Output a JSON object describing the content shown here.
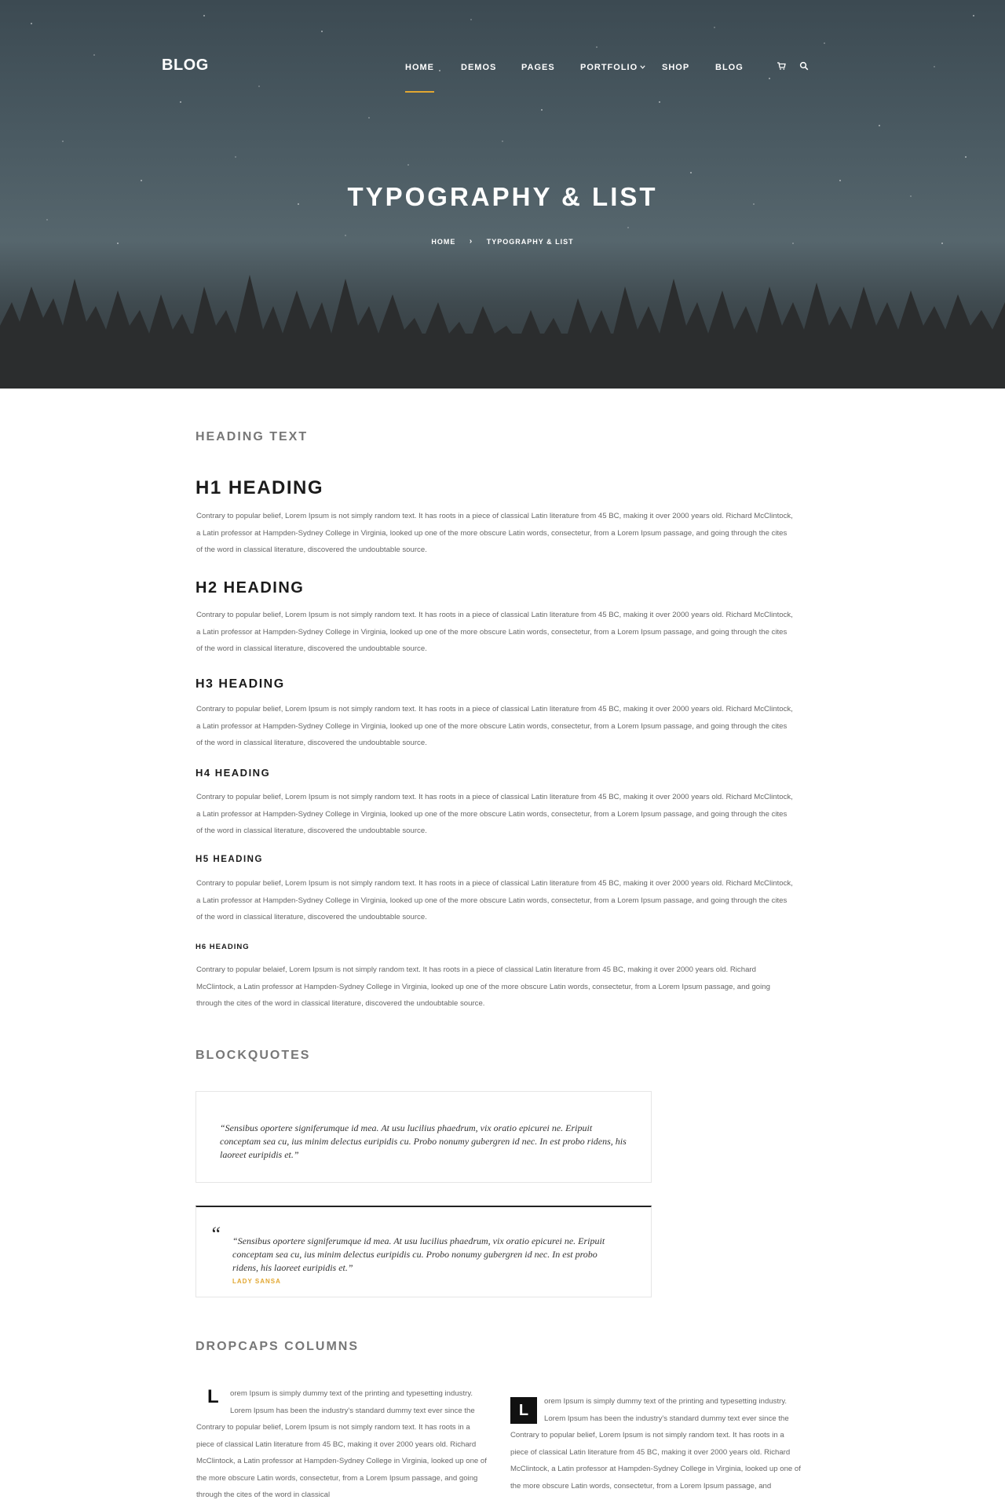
{
  "nav": {
    "logo": "BLOG",
    "items": [
      "HOME",
      "DEMOS",
      "PAGES",
      "PORTFOLIO",
      "SHOP",
      "BLOG"
    ],
    "active_index": 0
  },
  "hero": {
    "title": "TYPOGRAPHY & LIST",
    "breadcrumb": {
      "home": "HOME",
      "separator": "›",
      "current": "TYPOGRAPHY & LIST"
    }
  },
  "colors": {
    "accent": "#e2a731",
    "heading": "#1b1b1b",
    "body_text": "#666666",
    "section_title": "#777777"
  },
  "icons": {
    "cart": "cart-icon",
    "search": "search-icon",
    "chevron": "chevron-down-icon"
  },
  "heading_section": {
    "title": "HEADING TEXT",
    "headings": [
      {
        "label": "H1 HEADING",
        "paragraph": "Contrary to popular belief, Lorem Ipsum is not simply random text. It has roots in a piece of classical Latin literature from 45 BC, making it over 2000 years old. Richard McClintock, a Latin professor at Hampden-Sydney College in Virginia, looked up one of the more obscure Latin words, consectetur, from a Lorem Ipsum passage, and going through the cites of the word in classical literature, discovered the undoubtable source."
      },
      {
        "label": "H2 HEADING",
        "paragraph": "Contrary to popular belief, Lorem Ipsum is not simply random text. It has roots in a piece of classical Latin literature from 45 BC, making it over 2000 years old. Richard McClintock, a Latin professor at Hampden-Sydney College in Virginia, looked up one of the more obscure Latin words, consectetur, from a Lorem Ipsum passage, and going through the cites of the word in classical literature, discovered the undoubtable source."
      },
      {
        "label": "H3 HEADING",
        "paragraph": "Contrary to popular belief, Lorem Ipsum is not simply random text. It has roots in a piece of classical Latin literature from 45 BC, making it over 2000 years old. Richard McClintock, a Latin professor at Hampden-Sydney College in Virginia, looked up one of the more obscure Latin words, consectetur, from a Lorem Ipsum passage, and going through the cites of the word in classical literature, discovered the undoubtable source."
      },
      {
        "label": "H4 HEADING",
        "paragraph": "Contrary to popular belief, Lorem Ipsum is not simply random text. It has roots in a piece of classical Latin literature from 45 BC, making it over 2000 years old. Richard McClintock, a Latin professor at Hampden-Sydney College in Virginia, looked up one of the more obscure Latin words, consectetur, from a Lorem Ipsum passage, and going through the cites of the word in classical literature, discovered the undoubtable source."
      },
      {
        "label": "H5 HEADING",
        "paragraph": "Contrary to popular belief, Lorem Ipsum is not simply random text. It has roots in a piece of classical Latin literature from 45 BC, making it over 2000 years old. Richard McClintock, a Latin professor at Hampden-Sydney College in Virginia, looked up one of the more obscure Latin words, consectetur, from a Lorem Ipsum passage, and going through the cites of the word in classical literature, discovered the undoubtable source."
      },
      {
        "label": "H6 HEADING",
        "paragraph": "Contrary to popular belaief, Lorem Ipsum is not simply random text. It has roots in a piece of classical Latin literature from 45 BC, making it over 2000 years old. Richard McClintock, a Latin professor at Hampden-Sydney College in Virginia, looked up one of the more obscure Latin words, consectetur, from a Lorem Ipsum passage, and going through the cites of the word in classical literature, discovered the undoubtable source."
      }
    ]
  },
  "blockquotes": {
    "title": "BLOCKQUOTES",
    "quote1": "“Sensibus oportere signiferumque id mea. At usu lucilius phaedrum, vix oratio epicurei ne. Eripuit conceptam sea cu, ius minim delectus euripidis cu. Probo nonumy gubergren id nec. In est probo ridens, his laoreet euripidis et.”",
    "quote2_mark": "“",
    "quote2": "“Sensibus oportere signiferumque id mea. At usu lucilius phaedrum, vix oratio epicurei ne. Eripuit conceptam sea cu, ius minim delectus euripidis cu. Probo nonumy gubergren id nec. In est probo ridens, his laoreet euripidis et.”",
    "quote2_author": "LADY SANSA"
  },
  "dropcaps": {
    "title": "DROPCAPS  COLUMNS",
    "col1": {
      "letter": "L",
      "first_lines": "orem Ipsum is simply dummy text of the printing and typesetting industry. Lorem Ipsum has been the industry's standard dummy text ever since the",
      "rest": "Contrary to popular belief, Lorem Ipsum is not simply random text. It has roots in a piece of classical Latin literature from 45 BC, making it over 2000 years old. Richard McClintock, a Latin professor at Hampden-Sydney College in Virginia, looked up one of the more obscure Latin words, consectetur, from a Lorem Ipsum passage, and going through the cites of the word in classical"
    },
    "col2": {
      "letter": "L",
      "first_lines": "orem Ipsum is simply dummy text of the printing and typesetting industry. Lorem Ipsum has been the industry's standard dummy text ever since the",
      "rest": "Contrary to popular belief, Lorem Ipsum is not simply random text. It has roots in a piece of classical Latin literature from 45 BC, making it over 2000 years old. Richard McClintock, a Latin professor at Hampden-Sydney College in Virginia, looked up one of the more obscure Latin words, consectetur, from a Lorem Ipsum passage, and"
    }
  }
}
